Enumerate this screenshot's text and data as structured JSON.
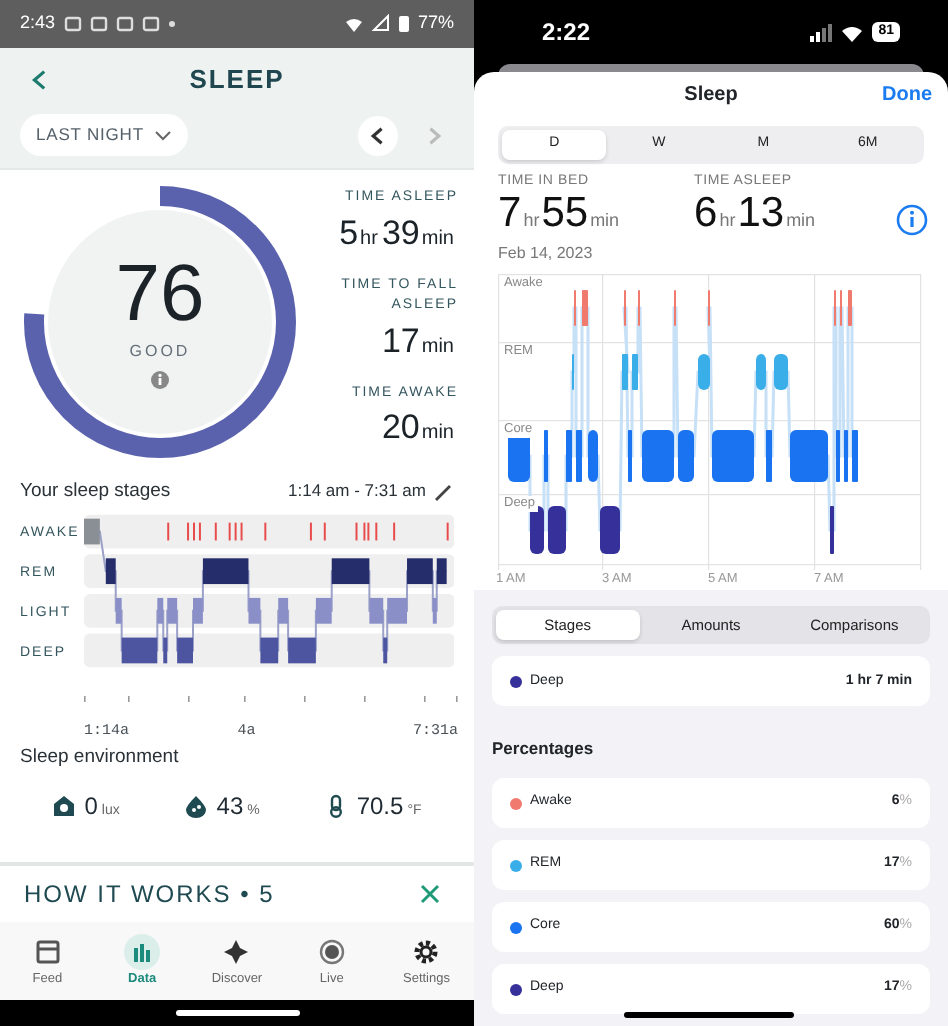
{
  "left_app": {
    "status_bar": {
      "time": "2:43",
      "battery": "77%"
    },
    "header": {
      "title": "SLEEP",
      "range": "LAST NIGHT",
      "prev_disabled": false,
      "next_disabled": true
    },
    "score": {
      "value": "76",
      "rating": "GOOD",
      "level": 0.76
    },
    "stats": [
      {
        "label": "TIME ASLEEP",
        "parts": [
          {
            "num": "5",
            "unit": "hr"
          },
          {
            "num": "39",
            "unit": "min"
          }
        ]
      },
      {
        "label": "TIME TO FALL ASLEEP",
        "parts": [
          {
            "num": "17",
            "unit": "min"
          }
        ]
      },
      {
        "label": "TIME AWAKE",
        "parts": [
          {
            "num": "20",
            "unit": "min"
          }
        ]
      }
    ],
    "stages": {
      "title": "Your sleep stages",
      "range": "1:14 am - 7:31 am",
      "labels": [
        "AWAKE",
        "REM",
        "LIGHT",
        "DEEP"
      ],
      "axis_labels": [
        "1:14a",
        "4a",
        "7:31a"
      ]
    },
    "environment": {
      "title": "Sleep environment",
      "items": [
        {
          "kind": "light",
          "value": "0",
          "unit": "lux"
        },
        {
          "kind": "humidity",
          "value": "43",
          "unit": "%"
        },
        {
          "kind": "temperature",
          "value": "70.5",
          "unit": "°F"
        }
      ]
    },
    "banner": {
      "title": "HOW IT WORKS • 5"
    },
    "nav": [
      {
        "kind": "feed",
        "label": "Feed",
        "selected": false
      },
      {
        "kind": "data",
        "label": "Data",
        "selected": true
      },
      {
        "kind": "discover",
        "label": "Discover",
        "selected": false
      },
      {
        "kind": "live",
        "label": "Live",
        "selected": false
      },
      {
        "kind": "settings",
        "label": "Settings",
        "selected": false
      }
    ]
  },
  "right_app": {
    "status_bar": {
      "time": "2:22",
      "battery": "81"
    },
    "sheet": {
      "title": "Sleep",
      "done": "Done"
    },
    "periods": [
      {
        "label": "D",
        "selected": true
      },
      {
        "label": "W",
        "selected": false
      },
      {
        "label": "M",
        "selected": false
      },
      {
        "label": "6M",
        "selected": false
      }
    ],
    "metrics": [
      {
        "label": "TIME IN BED",
        "parts": [
          {
            "num": "7",
            "unit": "hr"
          },
          {
            "num": "55",
            "unit": "min"
          }
        ]
      },
      {
        "label": "TIME ASLEEP",
        "parts": [
          {
            "num": "6",
            "unit": "hr"
          },
          {
            "num": "13",
            "unit": "min"
          }
        ]
      }
    ],
    "date": "Feb 14, 2023",
    "chart": {
      "labels": [
        "Awake",
        "REM",
        "Core",
        "Deep"
      ],
      "axis_labels": [
        "1 AM",
        "3 AM",
        "5 AM",
        "7 AM"
      ]
    },
    "views": [
      {
        "label": "Stages",
        "selected": true
      },
      {
        "label": "Amounts",
        "selected": false
      },
      {
        "label": "Comparisons",
        "selected": false
      }
    ],
    "selected_stage": {
      "name": "Deep",
      "color": "#35309a",
      "value": "1 hr 7 min"
    },
    "percentages_title": "Percentages",
    "percentages": [
      {
        "name": "Awake",
        "color": "#f07a6e",
        "value": "6",
        "unit": "%"
      },
      {
        "name": "REM",
        "color": "#3aaee8",
        "value": "17",
        "unit": "%"
      },
      {
        "name": "Core",
        "color": "#1a73f0",
        "value": "60",
        "unit": "%"
      },
      {
        "name": "Deep",
        "color": "#35309a",
        "value": "17",
        "unit": "%"
      }
    ]
  }
}
